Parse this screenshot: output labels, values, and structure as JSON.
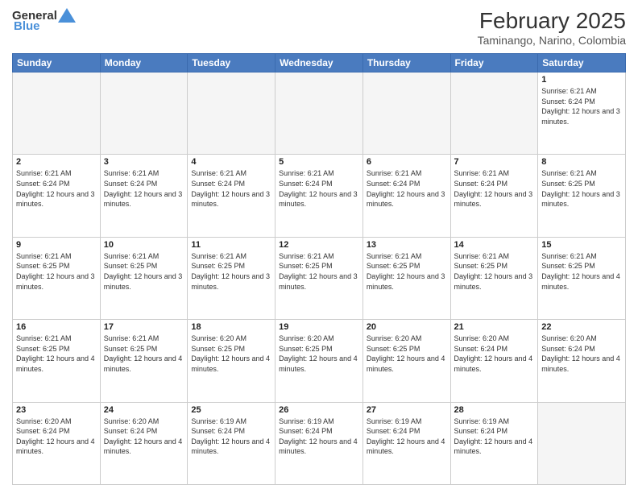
{
  "header": {
    "logo": {
      "general": "General",
      "blue": "Blue"
    },
    "title": "February 2025",
    "location": "Taminango, Narino, Colombia"
  },
  "weekdays": [
    "Sunday",
    "Monday",
    "Tuesday",
    "Wednesday",
    "Thursday",
    "Friday",
    "Saturday"
  ],
  "weeks": [
    [
      {
        "day": "",
        "empty": true
      },
      {
        "day": "",
        "empty": true
      },
      {
        "day": "",
        "empty": true
      },
      {
        "day": "",
        "empty": true
      },
      {
        "day": "",
        "empty": true
      },
      {
        "day": "",
        "empty": true
      },
      {
        "day": "1",
        "sunrise": "6:21 AM",
        "sunset": "6:24 PM",
        "daylight": "12 hours and 3 minutes."
      }
    ],
    [
      {
        "day": "2",
        "sunrise": "6:21 AM",
        "sunset": "6:24 PM",
        "daylight": "12 hours and 3 minutes."
      },
      {
        "day": "3",
        "sunrise": "6:21 AM",
        "sunset": "6:24 PM",
        "daylight": "12 hours and 3 minutes."
      },
      {
        "day": "4",
        "sunrise": "6:21 AM",
        "sunset": "6:24 PM",
        "daylight": "12 hours and 3 minutes."
      },
      {
        "day": "5",
        "sunrise": "6:21 AM",
        "sunset": "6:24 PM",
        "daylight": "12 hours and 3 minutes."
      },
      {
        "day": "6",
        "sunrise": "6:21 AM",
        "sunset": "6:24 PM",
        "daylight": "12 hours and 3 minutes."
      },
      {
        "day": "7",
        "sunrise": "6:21 AM",
        "sunset": "6:24 PM",
        "daylight": "12 hours and 3 minutes."
      },
      {
        "day": "8",
        "sunrise": "6:21 AM",
        "sunset": "6:25 PM",
        "daylight": "12 hours and 3 minutes."
      }
    ],
    [
      {
        "day": "9",
        "sunrise": "6:21 AM",
        "sunset": "6:25 PM",
        "daylight": "12 hours and 3 minutes."
      },
      {
        "day": "10",
        "sunrise": "6:21 AM",
        "sunset": "6:25 PM",
        "daylight": "12 hours and 3 minutes."
      },
      {
        "day": "11",
        "sunrise": "6:21 AM",
        "sunset": "6:25 PM",
        "daylight": "12 hours and 3 minutes."
      },
      {
        "day": "12",
        "sunrise": "6:21 AM",
        "sunset": "6:25 PM",
        "daylight": "12 hours and 3 minutes."
      },
      {
        "day": "13",
        "sunrise": "6:21 AM",
        "sunset": "6:25 PM",
        "daylight": "12 hours and 3 minutes."
      },
      {
        "day": "14",
        "sunrise": "6:21 AM",
        "sunset": "6:25 PM",
        "daylight": "12 hours and 3 minutes."
      },
      {
        "day": "15",
        "sunrise": "6:21 AM",
        "sunset": "6:25 PM",
        "daylight": "12 hours and 4 minutes."
      }
    ],
    [
      {
        "day": "16",
        "sunrise": "6:21 AM",
        "sunset": "6:25 PM",
        "daylight": "12 hours and 4 minutes."
      },
      {
        "day": "17",
        "sunrise": "6:21 AM",
        "sunset": "6:25 PM",
        "daylight": "12 hours and 4 minutes."
      },
      {
        "day": "18",
        "sunrise": "6:20 AM",
        "sunset": "6:25 PM",
        "daylight": "12 hours and 4 minutes."
      },
      {
        "day": "19",
        "sunrise": "6:20 AM",
        "sunset": "6:25 PM",
        "daylight": "12 hours and 4 minutes."
      },
      {
        "day": "20",
        "sunrise": "6:20 AM",
        "sunset": "6:25 PM",
        "daylight": "12 hours and 4 minutes."
      },
      {
        "day": "21",
        "sunrise": "6:20 AM",
        "sunset": "6:24 PM",
        "daylight": "12 hours and 4 minutes."
      },
      {
        "day": "22",
        "sunrise": "6:20 AM",
        "sunset": "6:24 PM",
        "daylight": "12 hours and 4 minutes."
      }
    ],
    [
      {
        "day": "23",
        "sunrise": "6:20 AM",
        "sunset": "6:24 PM",
        "daylight": "12 hours and 4 minutes."
      },
      {
        "day": "24",
        "sunrise": "6:20 AM",
        "sunset": "6:24 PM",
        "daylight": "12 hours and 4 minutes."
      },
      {
        "day": "25",
        "sunrise": "6:19 AM",
        "sunset": "6:24 PM",
        "daylight": "12 hours and 4 minutes."
      },
      {
        "day": "26",
        "sunrise": "6:19 AM",
        "sunset": "6:24 PM",
        "daylight": "12 hours and 4 minutes."
      },
      {
        "day": "27",
        "sunrise": "6:19 AM",
        "sunset": "6:24 PM",
        "daylight": "12 hours and 4 minutes."
      },
      {
        "day": "28",
        "sunrise": "6:19 AM",
        "sunset": "6:24 PM",
        "daylight": "12 hours and 4 minutes."
      },
      {
        "day": "",
        "empty": true
      }
    ]
  ]
}
